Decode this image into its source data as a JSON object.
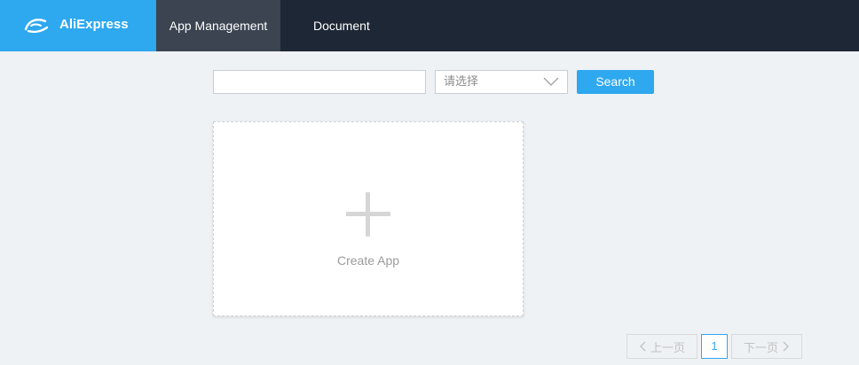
{
  "header": {
    "brand_name": "AliExpress",
    "brand_logo_icon": "aliexpress-logo-icon",
    "brand_color": "#2ea8ef",
    "nav": [
      {
        "label": "App Management",
        "active": true
      },
      {
        "label": "Document",
        "active": false
      }
    ]
  },
  "search": {
    "input_value": "",
    "input_placeholder": "",
    "select_value": "请选择",
    "select_icon": "chevron-down-icon",
    "button_label": "Search"
  },
  "create_card": {
    "icon": "plus-icon",
    "label": "Create App"
  },
  "pagination": {
    "prev_label": "上一页",
    "current_page": "1",
    "next_label": "下一页",
    "prev_icon": "chevron-left-icon",
    "next_icon": "chevron-right-icon"
  }
}
